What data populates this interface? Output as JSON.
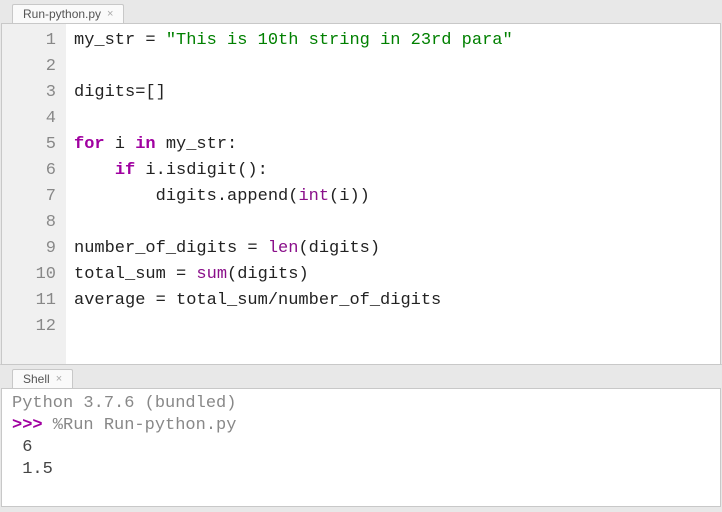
{
  "editor": {
    "tab_label": "Run-python.py",
    "line_numbers": [
      "1",
      "2",
      "3",
      "4",
      "5",
      "6",
      "7",
      "8",
      "9",
      "10",
      "11",
      "12"
    ],
    "tokens": {
      "l1_var": "my_str",
      "l1_eq": " = ",
      "l1_str": "\"This is 10th string in 23rd para\"",
      "l3": "digits=[]",
      "l5_for": "for",
      "l5_mid": " i ",
      "l5_in": "in",
      "l5_rest": " my_str:",
      "l6_indent": "    ",
      "l6_if": "if",
      "l6_rest": " i.isdigit():",
      "l7_indent": "        digits.append(",
      "l7_int": "int",
      "l7_rest": "(i))",
      "l9_a": "number_of_digits = ",
      "l9_len": "len",
      "l9_b": "(digits)",
      "l10_a": "total_sum = ",
      "l10_sum": "sum",
      "l10_b": "(digits)",
      "l11": "average = total_sum/number_of_digits"
    }
  },
  "shell": {
    "tab_label": "Shell",
    "banner": "Python 3.7.6 (bundled)",
    "prompt": ">>>",
    "run_cmd": " %Run Run-python.py",
    "output_1": " 6",
    "output_2": " 1.5"
  }
}
